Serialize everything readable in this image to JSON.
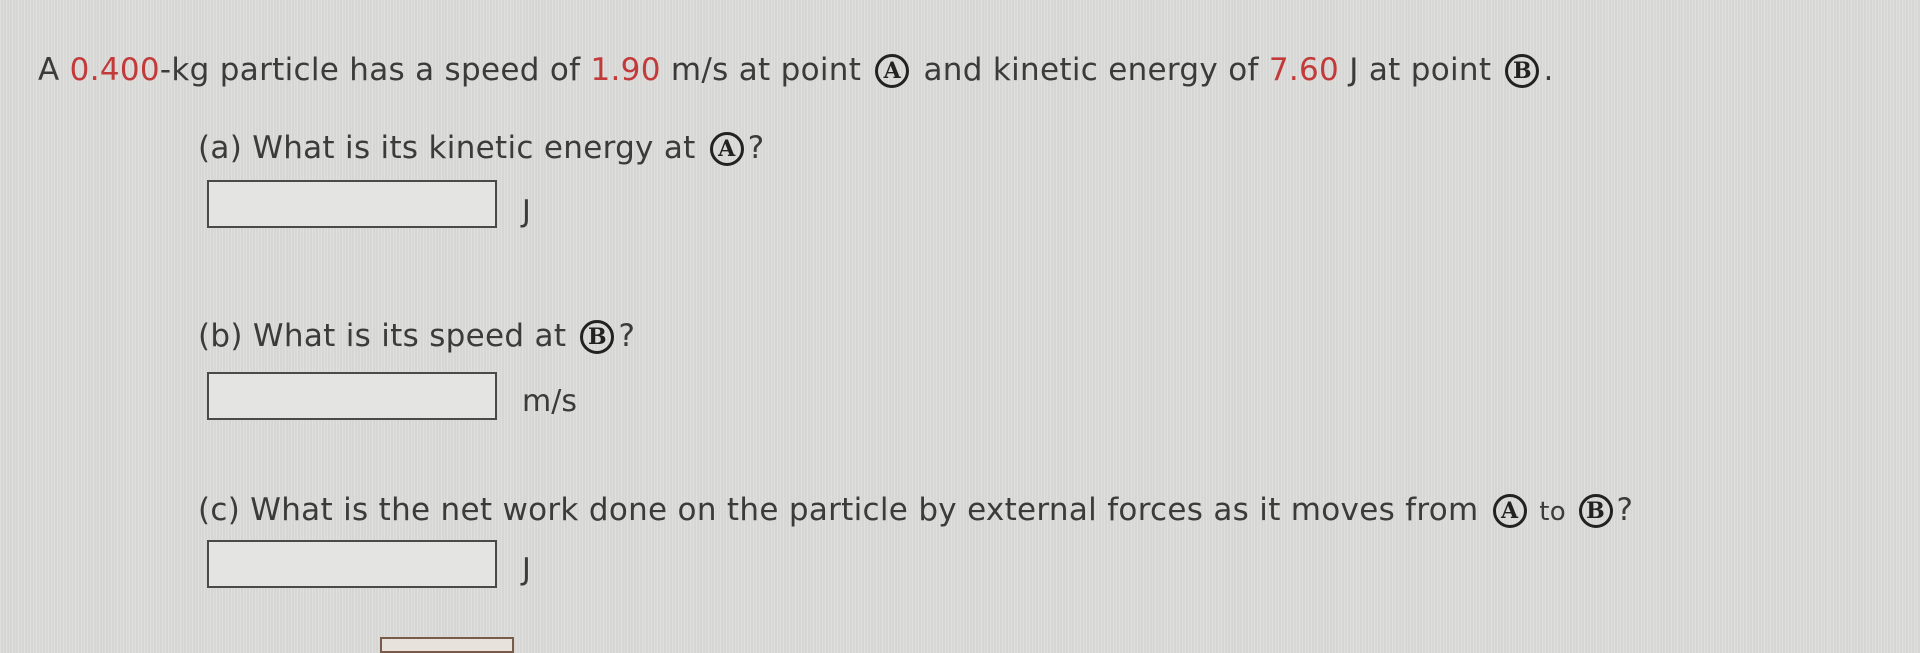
{
  "problem": {
    "intro_a": "A ",
    "mass": "0.400",
    "intro_b": "-kg particle has a speed of ",
    "speed": "1.90",
    "intro_c": " m/s at point ",
    "intro_d": " and kinetic energy of ",
    "energy": "7.60",
    "intro_e": " J at point ",
    "intro_f": ".",
    "point_a": "A",
    "point_b": "B"
  },
  "questions": [
    {
      "prefix": "(a) What is its kinetic energy at ",
      "suffix": "?",
      "unit": "J",
      "value": ""
    },
    {
      "prefix": "(b) What is its speed at ",
      "suffix": "?",
      "unit": "m/s",
      "value": ""
    },
    {
      "prefix": "(c) What is the net work done on the particle by external forces as it moves from ",
      "middle": " to ",
      "suffix": "?",
      "unit": "J",
      "value": ""
    }
  ],
  "colors": {
    "given_value": "#c23a3a"
  }
}
